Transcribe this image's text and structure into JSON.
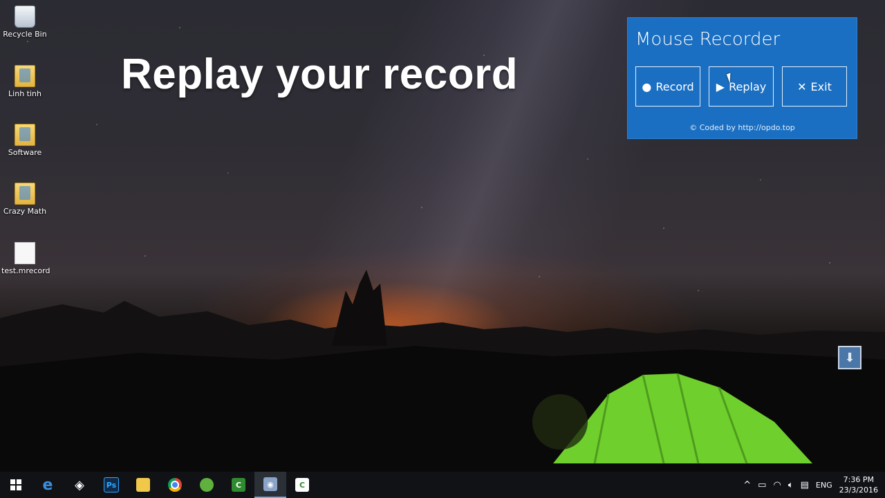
{
  "desktop": {
    "icons": [
      {
        "label": "Recycle Bin",
        "icon": "recycle-bin-icon"
      },
      {
        "label": "Linh tinh",
        "icon": "folder-icon"
      },
      {
        "label": "Software",
        "icon": "folder-icon"
      },
      {
        "label": "Crazy Math",
        "icon": "folder-icon"
      },
      {
        "label": "test.mrecord",
        "icon": "file-icon"
      }
    ]
  },
  "overlay": {
    "title": "Replay your record"
  },
  "app": {
    "title": "Mouse Recorder",
    "accent": "#1a6fc2",
    "buttons": {
      "record": {
        "label": "Record",
        "icon": "record-dot-icon"
      },
      "replay": {
        "label": "Replay",
        "icon": "play-icon"
      },
      "exit": {
        "label": "Exit",
        "icon": "close-icon"
      }
    },
    "footer": "© Coded by http://opdo.top"
  },
  "taskbar": {
    "apps": [
      "start-icon",
      "edge-icon",
      "unity-icon",
      "photoshop-icon",
      "file-explorer-icon",
      "chrome-icon",
      "app-icon",
      "camtasia-icon",
      "mouse-recorder-icon",
      "camtasia-recorder-icon"
    ],
    "photoshop_label": "Ps",
    "tray": {
      "language": "ENG",
      "time": "7:36 PM",
      "date": "23/3/2016"
    }
  }
}
